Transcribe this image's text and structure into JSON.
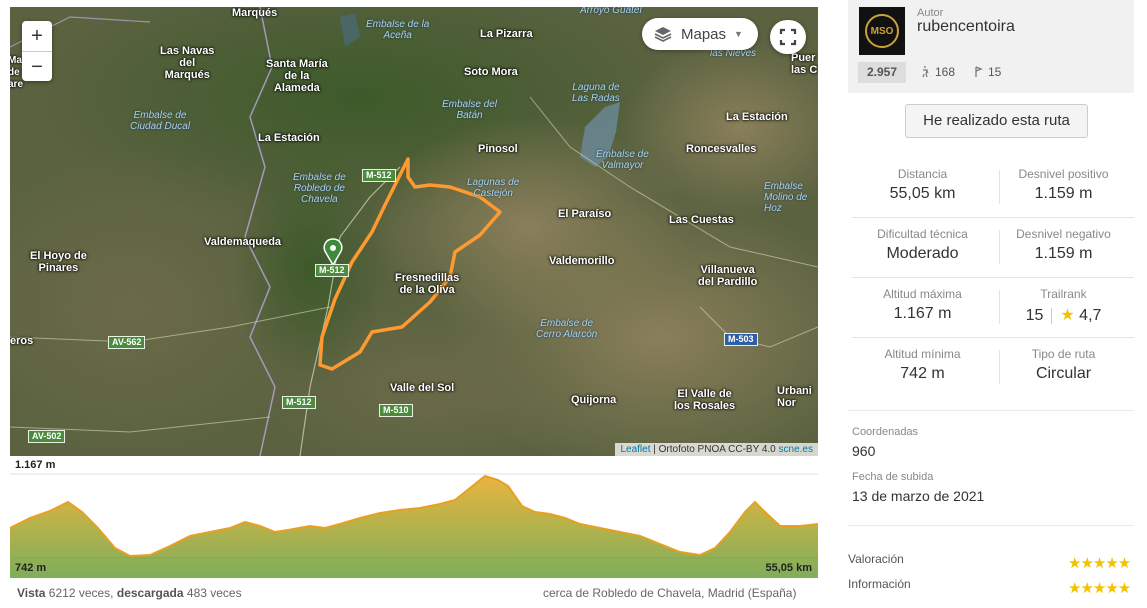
{
  "map": {
    "zoom_in": "+",
    "zoom_out": "−",
    "layers_label": "Mapas",
    "attribution_link": "Leaflet",
    "attribution_text": " | Ortofoto PNOA CC-BY 4.0 ",
    "attribution_site": "scne.es",
    "places": {
      "marques_top": "Marqués",
      "las_navas": "Las Navas\ndel\nMarqués",
      "santa_maria": "Santa María\nde la\nAlameda",
      "la_pizarra": "La Pizarra",
      "soto_mora": "Soto Mora",
      "la_estacion_1": "La Estación",
      "pinosol": "Pinosol",
      "la_estacion_2": "La Estación",
      "roncesvalles": "Roncesvalles",
      "el_paraiso": "El Paraíso",
      "las_cuestas": "Las Cuestas",
      "valdemaqueda": "Valdemaqueda",
      "el_hoyo": "El Hoyo de\nPinares",
      "valdemorillo": "Valdemorillo",
      "fresnedillas": "Fresnedillas\nde la Oliva",
      "villanueva": "Villanueva\ndel Pardillo",
      "eros": "eros",
      "valle_del_sol": "Valle del Sol",
      "quijorna": "Quijorna",
      "el_valle": "El Valle de\nlos Rosales",
      "urbani": "Urbani\nNor",
      "puerto_las": "Puer\nlas C",
      "nieves": "las Nieves",
      "arroyo_guatel": "Arroyo Guatel",
      "left_edge": "Ma\nde\nare"
    },
    "water": {
      "embalse_acena": "Embalse de la\nAceña",
      "embalse_ciudad_ducal": "Embalse de\nCiudad Ducal",
      "embalse_batan": "Embalse del\nBatán",
      "laguna_radas": "Laguna de\nLas Radas",
      "embalse_robledo": "Embalse de\nRobledo de\nChavela",
      "lagunas_castejon": "Lagunas de\nCastejón",
      "embalse_valmayor": "Embalse de\nValmayor",
      "embalse_molino": "Embalse\nMolino de\nHoz",
      "embalse_cerro": "Embalse de\nCerro Alarcón"
    },
    "roads": {
      "m512_a": "M-512",
      "m512_b": "M-512",
      "m512_c": "M-512",
      "av562": "AV-562",
      "m510": "M-510",
      "av502": "AV-502",
      "m503": "M-503"
    }
  },
  "elevation": {
    "max": "1.167 m",
    "min": "742 m",
    "distance": "55,05 km"
  },
  "footer": {
    "views_label": "Vista",
    "views_text": " 6212 veces, ",
    "downloads_label": "descargada",
    "downloads_text": " 483 veces",
    "location": "cerca de Robledo de Chavela, Madrid (España)"
  },
  "author": {
    "logo_text": "MSO",
    "caption": "Autor",
    "name": "rubencentoira",
    "rank": "2.957",
    "followers": "168",
    "routes": "15"
  },
  "done_button": "He realizado esta ruta",
  "stats": {
    "distance_label": "Distancia",
    "distance_value": "55,05 km",
    "gain_label": "Desnivel positivo",
    "gain_value": "1.159 m",
    "difficulty_label": "Dificultad técnica",
    "difficulty_value": "Moderado",
    "loss_label": "Desnivel negativo",
    "loss_value": "1.159 m",
    "max_alt_label": "Altitud máxima",
    "max_alt_value": "1.167 m",
    "trailrank_label": "Trailrank",
    "trailrank_value": "15",
    "trailrank_rating": "4,7",
    "min_alt_label": "Altitud mínima",
    "min_alt_value": "742 m",
    "type_label": "Tipo de ruta",
    "type_value": "Circular"
  },
  "meta": {
    "coords_label": "Coordenadas",
    "coords_value": "960",
    "upload_label": "Fecha de subida",
    "upload_value": "13 de marzo de 2021"
  },
  "ratings": {
    "valoracion_label": "Valoración",
    "informacion_label": "Información",
    "valoracion_stars": 4.5,
    "informacion_stars": 4.5
  }
}
